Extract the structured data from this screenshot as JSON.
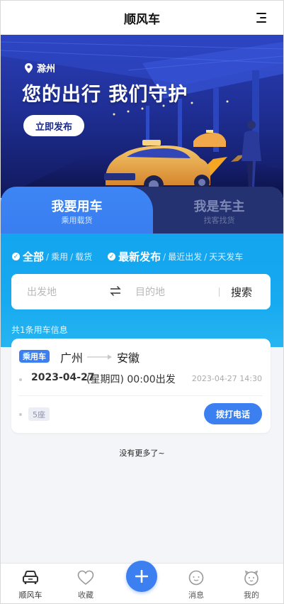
{
  "header": {
    "title": "顺风车"
  },
  "banner": {
    "city": "滁州",
    "slogan": "您的出行 我们守护",
    "publish_label": "立即发布"
  },
  "tabs": [
    {
      "title": "我要用车",
      "subtitle": "乘用载货",
      "active": true
    },
    {
      "title": "我是车主",
      "subtitle": "找客找货",
      "active": false
    }
  ],
  "filters": {
    "type_main": "全部",
    "type_options": [
      "乘用",
      "载货"
    ],
    "sort_main": "最新发布",
    "sort_options": [
      "最近出发",
      "天天发车"
    ]
  },
  "search": {
    "from_placeholder": "出发地",
    "to_placeholder": "目的地",
    "button_label": "搜索"
  },
  "result_count_text": "共1条用车信息",
  "listings": [
    {
      "badge": "乘用车",
      "from": "广州",
      "to": "安徽",
      "date": "2023-04-27",
      "weekday_time": "(星期四) 00:00出发",
      "posted": "2023-04-27 14:30",
      "seats": "5座",
      "call_label": "拨打电话"
    }
  ],
  "no_more_text": "没有更多了~",
  "nav": [
    {
      "label": "顺风车",
      "icon": "car-icon"
    },
    {
      "label": "收藏",
      "icon": "heart-icon"
    },
    {
      "label": "",
      "icon": "plus-icon"
    },
    {
      "label": "消息",
      "icon": "message-icon"
    },
    {
      "label": "我的",
      "icon": "profile-icon"
    }
  ],
  "colors": {
    "primary": "#3b7ff0",
    "search_bg": "#16aaf0",
    "tab_inactive_bg": "#243271"
  }
}
